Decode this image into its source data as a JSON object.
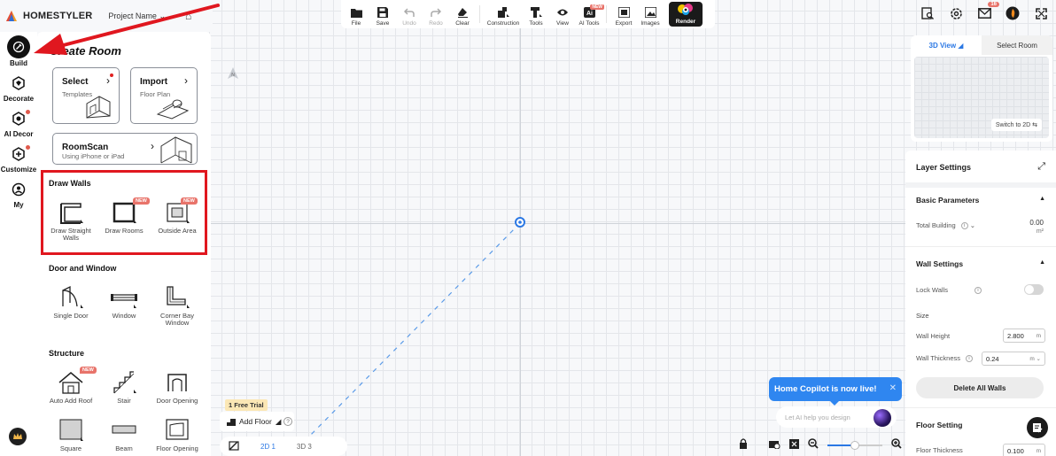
{
  "app": {
    "logo_text": "HOMESTYLER",
    "project_name": "Project Name",
    "colors": {
      "accent": "#2b78e4",
      "annotation": "#e0171f",
      "new_badge": "#e8736a"
    }
  },
  "rail": {
    "items": [
      {
        "label": "Build",
        "icon": "build-icon",
        "active": true
      },
      {
        "label": "Decorate",
        "icon": "decorate-icon"
      },
      {
        "label": "AI Decor",
        "icon": "ai-decor-icon",
        "dot": true
      },
      {
        "label": "Customize",
        "icon": "customize-icon",
        "dot": true
      },
      {
        "label": "My",
        "icon": "my-icon"
      }
    ]
  },
  "panel": {
    "title": "Create Room",
    "select": {
      "title": "Select",
      "subtitle": "Templates"
    },
    "import": {
      "title": "Import",
      "subtitle": "Floor Plan"
    },
    "roomscan": {
      "title": "RoomScan",
      "subtitle": "Using iPhone or iPad"
    },
    "draw_walls": {
      "heading": "Draw Walls",
      "tools": [
        {
          "label": "Draw Straight Walls"
        },
        {
          "label": "Draw Rooms",
          "badge": "NEW"
        },
        {
          "label": "Outside Area",
          "badge": "NEW"
        }
      ]
    },
    "door_window": {
      "heading": "Door and Window",
      "tools": [
        {
          "label": "Single Door"
        },
        {
          "label": "Window"
        },
        {
          "label": "Corner Bay Window"
        }
      ]
    },
    "structure": {
      "heading": "Structure",
      "tools": [
        {
          "label": "Auto Add Roof",
          "badge": "NEW"
        },
        {
          "label": "Stair"
        },
        {
          "label": "Door Opening"
        },
        {
          "label": "Square"
        },
        {
          "label": "Beam"
        },
        {
          "label": "Floor Opening"
        }
      ]
    }
  },
  "toolbar": {
    "items": [
      {
        "label": "File",
        "icon": "folder-icon"
      },
      {
        "label": "Save",
        "icon": "save-icon"
      },
      {
        "label": "Undo",
        "icon": "undo-icon",
        "disabled": true
      },
      {
        "label": "Redo",
        "icon": "redo-icon",
        "disabled": true
      },
      {
        "label": "Clear",
        "icon": "eraser-icon"
      },
      {
        "label": "Construction",
        "icon": "construction-icon"
      },
      {
        "label": "Tools",
        "icon": "tools-icon"
      },
      {
        "label": "View",
        "icon": "eye-icon"
      },
      {
        "label": "AI Tools",
        "icon": "ai-tools-icon",
        "badge": "NEW"
      },
      {
        "label": "Export",
        "icon": "export-icon"
      },
      {
        "label": "Images",
        "icon": "images-icon"
      },
      {
        "label": "Render",
        "icon": "render-icon"
      }
    ]
  },
  "topright": {
    "notification_count": "16"
  },
  "view_panel": {
    "tab_3d": "3D View",
    "tab_select": "Select Room",
    "switch_label": "Switch to 2D"
  },
  "settings": {
    "title": "Layer Settings",
    "basic": {
      "heading": "Basic Parameters",
      "total_building_label": "Total Building",
      "total_building_value": "0.00",
      "total_building_unit": "m²"
    },
    "wall": {
      "heading": "Wall Settings",
      "lock_walls_label": "Lock Walls",
      "size_label": "Size",
      "wall_height_label": "Wall Height",
      "wall_height_value": "2.800",
      "wall_height_unit": "m",
      "wall_thickness_label": "Wall Thickness",
      "wall_thickness_value": "0.24",
      "wall_thickness_unit": "m",
      "delete_all_label": "Delete All Walls"
    },
    "floor": {
      "heading": "Floor Setting",
      "floor_thickness_label": "Floor Thickness",
      "floor_thickness_value": "0.100",
      "floor_thickness_unit": "m"
    }
  },
  "floor_controls": {
    "trial": "1 Free Trial",
    "add_floor": "Add Floor",
    "view_2d": "2D",
    "view_3d": "3D"
  },
  "copilot": {
    "banner": "Home Copilot is now live!",
    "placeholder": "Let AI help you design"
  }
}
